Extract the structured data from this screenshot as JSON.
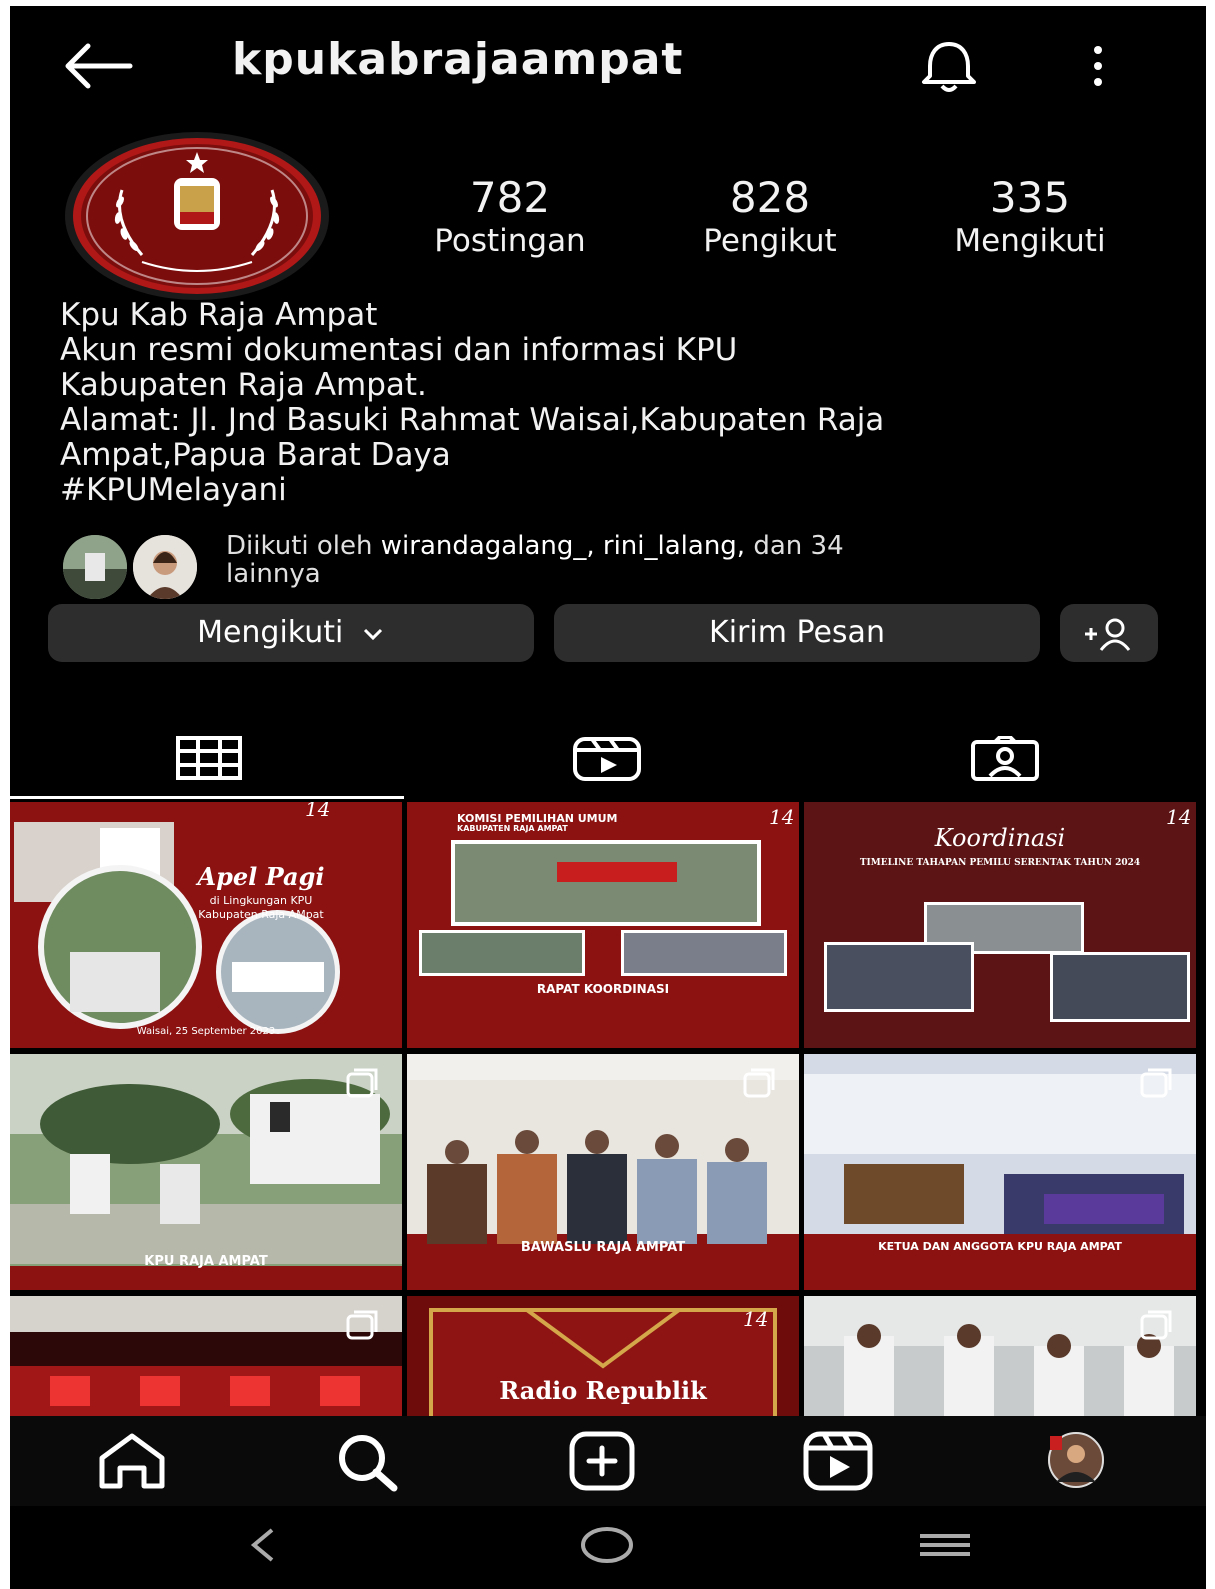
{
  "header": {
    "username": "kpukabrajaampat"
  },
  "profile": {
    "stats": [
      {
        "value": "782",
        "label": "Postingan"
      },
      {
        "value": "828",
        "label": "Pengikut"
      },
      {
        "value": "335",
        "label": "Mengikuti"
      }
    ],
    "bio_lines": [
      "Kpu Kab Raja Ampat",
      "Akun resmi dokumentasi dan informasi KPU",
      "Kabupaten Raja Ampat.",
      "Alamat: Jl. Jnd Basuki Rahmat Waisai,Kabupaten Raja",
      "Ampat,Papua Barat Daya",
      "#KPUMelayani"
    ],
    "followed_by": {
      "prefix": "Diikuti oleh",
      "names": "wirandagalang_, rini_lalang,",
      "suffix": "dan 34",
      "line2": "lainnya"
    }
  },
  "actions": {
    "following_label": "Mengikuti",
    "message_label": "Kirim Pesan"
  },
  "posts": [
    {
      "title": "Apel Pagi",
      "sub1": "di Lingkungan KPU",
      "sub2": "Kabupaten Raja AMpat",
      "footer": "Waisai, 25 September 2023",
      "badge": "14"
    },
    {
      "title": "RAPAT KOORDINASI",
      "header": "KOMISI PEMILIHAN UMUM",
      "header2": "KABUPATEN RAJA AMPAT",
      "badge": "14"
    },
    {
      "title": "Koordinasi",
      "sub1": "TIMELINE TAHAPAN PEMILU SERENTAK TAHUN 2024",
      "badge": "14"
    },
    {
      "title": "KPU RAJA AMPAT"
    },
    {
      "title": "BAWASLU RAJA AMPAT"
    },
    {
      "title": "KETUA DAN ANGGOTA KPU RAJA AMPAT"
    },
    {
      "title": ""
    },
    {
      "title": "Radio Republik",
      "badge": "14"
    },
    {
      "title": ""
    }
  ],
  "colors": {
    "background": "#000000",
    "button": "#2d2d2d",
    "kpu_red": "#8b1414"
  },
  "icons": {
    "back": "arrow-left-icon",
    "bell": "bell-icon",
    "more": "more-vertical-icon",
    "add_user": "add-user-icon",
    "grid": "grid-icon",
    "reels": "reels-icon",
    "tagged": "tagged-icon",
    "home": "home-icon",
    "search": "search-icon",
    "create": "create-icon",
    "profile": "profile-avatar"
  }
}
